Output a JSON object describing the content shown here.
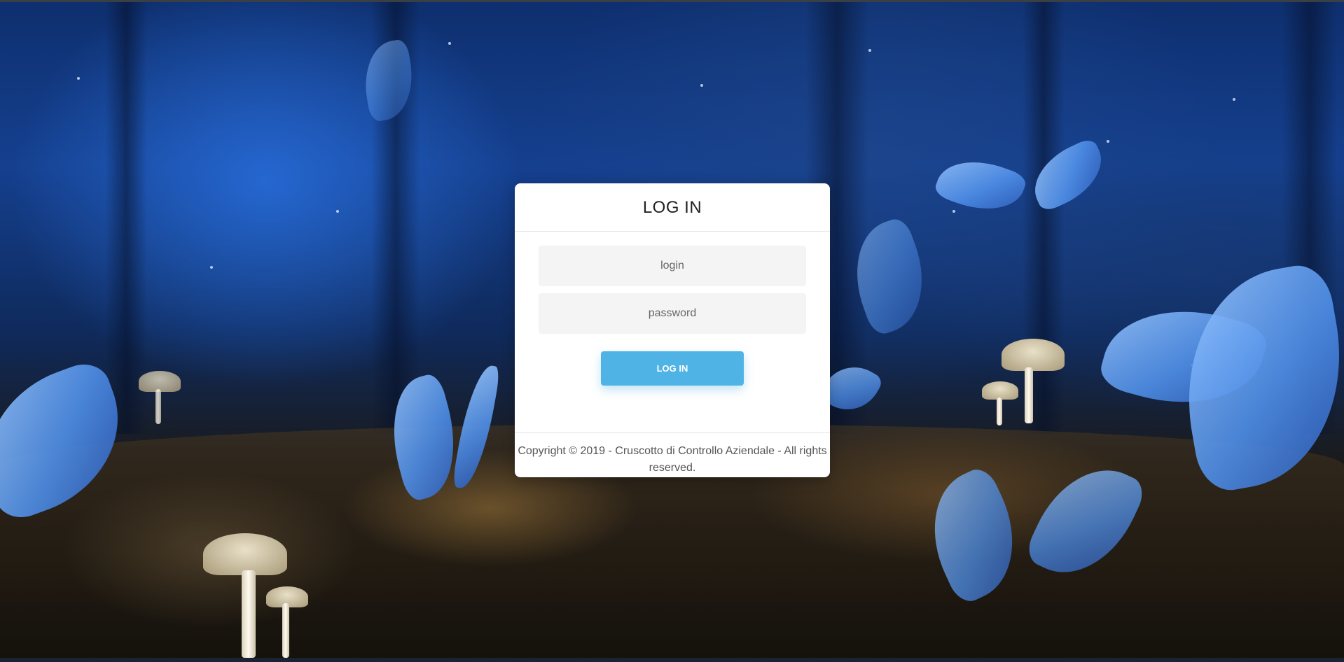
{
  "login_card": {
    "title": "LOG IN",
    "login_placeholder": "login",
    "password_placeholder": "password",
    "submit_label": "LOG IN",
    "footer_text": "Copyright © 2019 - Cruscotto di Controllo Aziendale - All rights reserved."
  },
  "colors": {
    "button_bg": "#4fb3e6",
    "card_bg": "#ffffff",
    "field_bg": "#f4f4f4"
  },
  "background": {
    "description_icon": "butterfly-forest-background"
  }
}
